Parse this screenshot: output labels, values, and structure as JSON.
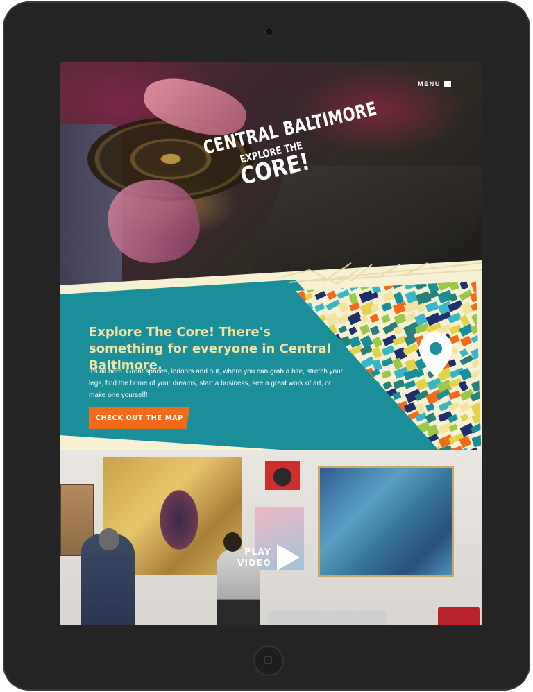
{
  "header": {
    "menu_label": "MENU"
  },
  "logo": {
    "line1": "CENTRAL BALTIMORE",
    "line2": "EXPLORE THE",
    "line3": "CORE!"
  },
  "explore": {
    "heading": "Explore The Core! There's something for everyone in Central Baltimore.",
    "body": "It's all here. Great spaces, indoors and out, where you can grab a bite, stretch your legs, find the home of your dreams, start a business, see a great work of art, or make one yourself!",
    "cta_label": "CHECK OUT THE MAP"
  },
  "video": {
    "play_line1": "PLAY",
    "play_line2": "VIDEO"
  },
  "icons": {
    "menu": "hamburger-icon",
    "map_pin": "map-pin-icon",
    "play": "play-icon"
  },
  "colors": {
    "teal": "#1a8f9a",
    "cream": "#f7f1d4",
    "orange": "#f26a1b",
    "heading": "#f3e3a1"
  }
}
